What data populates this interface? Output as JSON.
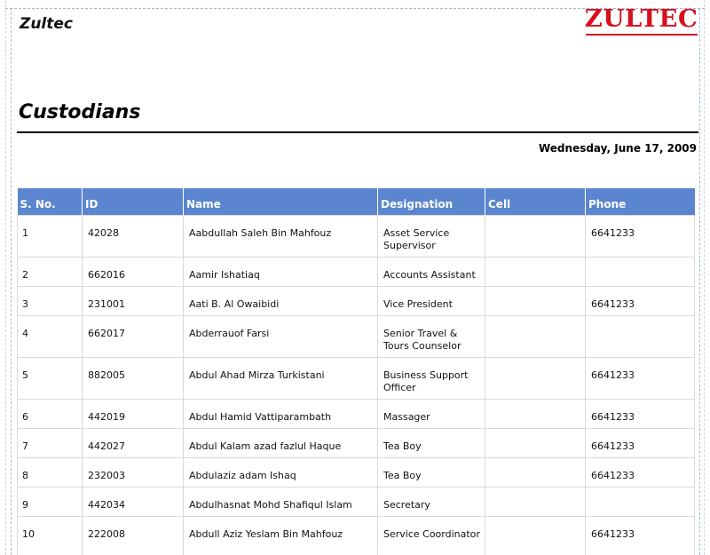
{
  "header": {
    "company": "Zultec",
    "logo_text": "ZULTEC",
    "title": "Custodians",
    "date": "Wednesday, June 17, 2009"
  },
  "colors": {
    "header_bg": "#5b86cf",
    "logo": "#d80f1c"
  },
  "table": {
    "columns": [
      "S. No.",
      "ID",
      "Name",
      "Designation",
      "Cell",
      "Phone"
    ],
    "rows": [
      {
        "sno": "1",
        "id": "42028",
        "name": "Aabdullah Saleh Bin Mahfouz",
        "designation": "Asset Service Supervisor",
        "cell": "",
        "phone": "6641233"
      },
      {
        "sno": "2",
        "id": "662016",
        "name": "Aamir Ishatiaq",
        "designation": "Accounts  Assistant",
        "cell": "",
        "phone": ""
      },
      {
        "sno": "3",
        "id": "231001",
        "name": "Aati B. Al Owaibidi",
        "designation": "Vice President",
        "cell": "",
        "phone": "6641233"
      },
      {
        "sno": "4",
        "id": "662017",
        "name": "Abderrauof Farsi",
        "designation": "Senior Travel & Tours Counselor",
        "cell": "",
        "phone": ""
      },
      {
        "sno": "5",
        "id": "882005",
        "name": "Abdul Ahad Mirza Turkistani",
        "designation": "Business Support Officer",
        "cell": "",
        "phone": "6641233"
      },
      {
        "sno": "6",
        "id": "442019",
        "name": "Abdul Hamid Vattiparambath",
        "designation": "Massager",
        "cell": "",
        "phone": "6641233"
      },
      {
        "sno": "7",
        "id": "442027",
        "name": "Abdul Kalam azad fazlul Haque",
        "designation": "Tea Boy",
        "cell": "",
        "phone": "6641233"
      },
      {
        "sno": "8",
        "id": "232003",
        "name": "Abdulaziz adam Ishaq",
        "designation": "Tea Boy",
        "cell": "",
        "phone": "6641233"
      },
      {
        "sno": "9",
        "id": "442034",
        "name": "Abdulhasnat Mohd Shafiqul Islam",
        "designation": "Secretary",
        "cell": "",
        "phone": ""
      },
      {
        "sno": "10",
        "id": "222008",
        "name": "Abdull Aziz Yeslam Bin Mahfouz",
        "designation": "Service Coordinator",
        "cell": "",
        "phone": "6641233"
      }
    ]
  }
}
